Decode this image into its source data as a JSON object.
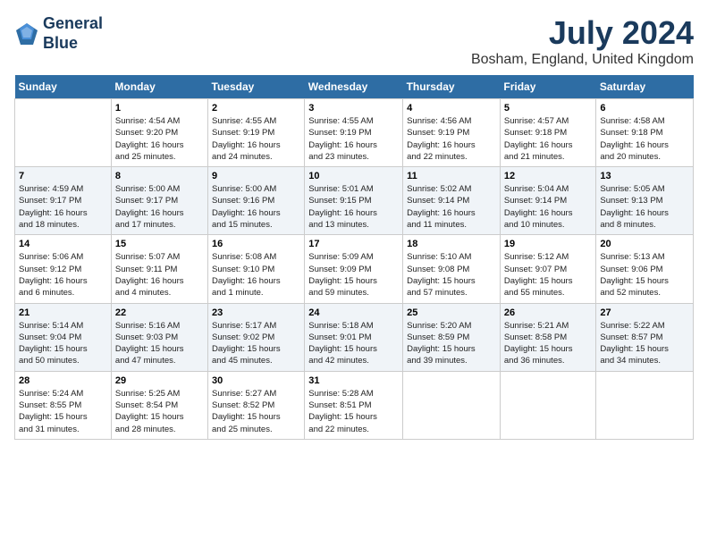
{
  "header": {
    "logo_line1": "General",
    "logo_line2": "Blue",
    "month": "July 2024",
    "location": "Bosham, England, United Kingdom"
  },
  "days_of_week": [
    "Sunday",
    "Monday",
    "Tuesday",
    "Wednesday",
    "Thursday",
    "Friday",
    "Saturday"
  ],
  "weeks": [
    [
      {
        "day": "",
        "info": ""
      },
      {
        "day": "1",
        "info": "Sunrise: 4:54 AM\nSunset: 9:20 PM\nDaylight: 16 hours\nand 25 minutes."
      },
      {
        "day": "2",
        "info": "Sunrise: 4:55 AM\nSunset: 9:19 PM\nDaylight: 16 hours\nand 24 minutes."
      },
      {
        "day": "3",
        "info": "Sunrise: 4:55 AM\nSunset: 9:19 PM\nDaylight: 16 hours\nand 23 minutes."
      },
      {
        "day": "4",
        "info": "Sunrise: 4:56 AM\nSunset: 9:19 PM\nDaylight: 16 hours\nand 22 minutes."
      },
      {
        "day": "5",
        "info": "Sunrise: 4:57 AM\nSunset: 9:18 PM\nDaylight: 16 hours\nand 21 minutes."
      },
      {
        "day": "6",
        "info": "Sunrise: 4:58 AM\nSunset: 9:18 PM\nDaylight: 16 hours\nand 20 minutes."
      }
    ],
    [
      {
        "day": "7",
        "info": "Sunrise: 4:59 AM\nSunset: 9:17 PM\nDaylight: 16 hours\nand 18 minutes."
      },
      {
        "day": "8",
        "info": "Sunrise: 5:00 AM\nSunset: 9:17 PM\nDaylight: 16 hours\nand 17 minutes."
      },
      {
        "day": "9",
        "info": "Sunrise: 5:00 AM\nSunset: 9:16 PM\nDaylight: 16 hours\nand 15 minutes."
      },
      {
        "day": "10",
        "info": "Sunrise: 5:01 AM\nSunset: 9:15 PM\nDaylight: 16 hours\nand 13 minutes."
      },
      {
        "day": "11",
        "info": "Sunrise: 5:02 AM\nSunset: 9:14 PM\nDaylight: 16 hours\nand 11 minutes."
      },
      {
        "day": "12",
        "info": "Sunrise: 5:04 AM\nSunset: 9:14 PM\nDaylight: 16 hours\nand 10 minutes."
      },
      {
        "day": "13",
        "info": "Sunrise: 5:05 AM\nSunset: 9:13 PM\nDaylight: 16 hours\nand 8 minutes."
      }
    ],
    [
      {
        "day": "14",
        "info": "Sunrise: 5:06 AM\nSunset: 9:12 PM\nDaylight: 16 hours\nand 6 minutes."
      },
      {
        "day": "15",
        "info": "Sunrise: 5:07 AM\nSunset: 9:11 PM\nDaylight: 16 hours\nand 4 minutes."
      },
      {
        "day": "16",
        "info": "Sunrise: 5:08 AM\nSunset: 9:10 PM\nDaylight: 16 hours\nand 1 minute."
      },
      {
        "day": "17",
        "info": "Sunrise: 5:09 AM\nSunset: 9:09 PM\nDaylight: 15 hours\nand 59 minutes."
      },
      {
        "day": "18",
        "info": "Sunrise: 5:10 AM\nSunset: 9:08 PM\nDaylight: 15 hours\nand 57 minutes."
      },
      {
        "day": "19",
        "info": "Sunrise: 5:12 AM\nSunset: 9:07 PM\nDaylight: 15 hours\nand 55 minutes."
      },
      {
        "day": "20",
        "info": "Sunrise: 5:13 AM\nSunset: 9:06 PM\nDaylight: 15 hours\nand 52 minutes."
      }
    ],
    [
      {
        "day": "21",
        "info": "Sunrise: 5:14 AM\nSunset: 9:04 PM\nDaylight: 15 hours\nand 50 minutes."
      },
      {
        "day": "22",
        "info": "Sunrise: 5:16 AM\nSunset: 9:03 PM\nDaylight: 15 hours\nand 47 minutes."
      },
      {
        "day": "23",
        "info": "Sunrise: 5:17 AM\nSunset: 9:02 PM\nDaylight: 15 hours\nand 45 minutes."
      },
      {
        "day": "24",
        "info": "Sunrise: 5:18 AM\nSunset: 9:01 PM\nDaylight: 15 hours\nand 42 minutes."
      },
      {
        "day": "25",
        "info": "Sunrise: 5:20 AM\nSunset: 8:59 PM\nDaylight: 15 hours\nand 39 minutes."
      },
      {
        "day": "26",
        "info": "Sunrise: 5:21 AM\nSunset: 8:58 PM\nDaylight: 15 hours\nand 36 minutes."
      },
      {
        "day": "27",
        "info": "Sunrise: 5:22 AM\nSunset: 8:57 PM\nDaylight: 15 hours\nand 34 minutes."
      }
    ],
    [
      {
        "day": "28",
        "info": "Sunrise: 5:24 AM\nSunset: 8:55 PM\nDaylight: 15 hours\nand 31 minutes."
      },
      {
        "day": "29",
        "info": "Sunrise: 5:25 AM\nSunset: 8:54 PM\nDaylight: 15 hours\nand 28 minutes."
      },
      {
        "day": "30",
        "info": "Sunrise: 5:27 AM\nSunset: 8:52 PM\nDaylight: 15 hours\nand 25 minutes."
      },
      {
        "day": "31",
        "info": "Sunrise: 5:28 AM\nSunset: 8:51 PM\nDaylight: 15 hours\nand 22 minutes."
      },
      {
        "day": "",
        "info": ""
      },
      {
        "day": "",
        "info": ""
      },
      {
        "day": "",
        "info": ""
      }
    ]
  ]
}
